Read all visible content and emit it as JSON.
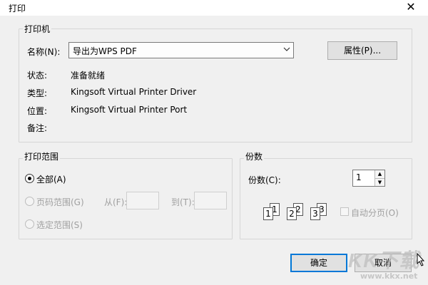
{
  "window": {
    "title": "打印",
    "close_glyph": "✕"
  },
  "printer": {
    "group_label": "打印机",
    "name_label": "名称(N):",
    "name_value": "导出为WPS PDF",
    "properties_button": "属性(P)...",
    "status_label": "状态:",
    "status_value": "准备就绪",
    "type_label": "类型:",
    "type_value": "Kingsoft Virtual Printer Driver",
    "location_label": "位置:",
    "location_value": "Kingsoft Virtual Printer Port",
    "comment_label": "备注:"
  },
  "print_range": {
    "group_label": "打印范围",
    "all_label": "全部(A)",
    "pages_label": "页码范围(G)",
    "from_label": "从(F):",
    "to_label": "到(T):",
    "selection_label": "选定范围(S)"
  },
  "copies": {
    "group_label": "份数",
    "copies_label": "份数(C):",
    "copies_value": "1",
    "collate_label": "自动分页(O)",
    "page_numbers": [
      "1",
      "1",
      "2",
      "2",
      "3",
      "3"
    ]
  },
  "buttons": {
    "ok": "确定",
    "cancel": "取消"
  },
  "watermark": {
    "text": "KK下载",
    "url": "www.kkx.net"
  },
  "colors": {
    "accent": "#0078d7",
    "watermark": "#c8c8c8"
  }
}
